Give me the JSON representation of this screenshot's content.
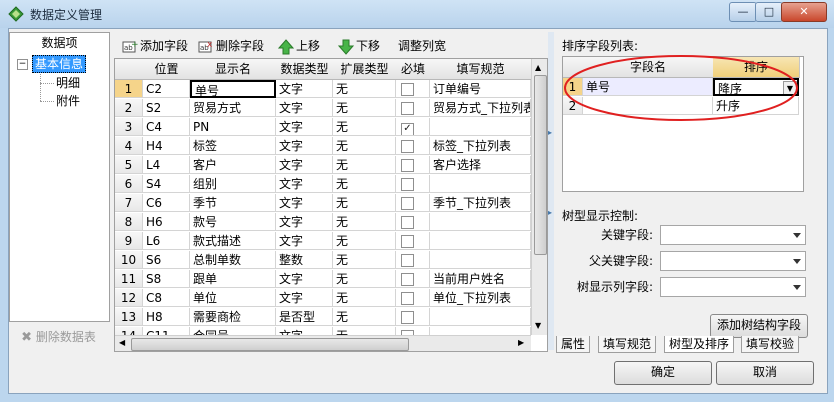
{
  "window": {
    "title": "数据定义管理",
    "buttons": {
      "minimize": "—",
      "maximize": "□",
      "close": "✕"
    }
  },
  "left_panel": {
    "header": "数据项",
    "tree": [
      {
        "label": "基本信息",
        "selected": true,
        "expanded": true
      },
      {
        "label": "明细"
      },
      {
        "label": "附件"
      }
    ],
    "delete_button": "删除数据表"
  },
  "toolbar": {
    "add_field": "添加字段",
    "delete_field": "删除字段",
    "move_up": "上移",
    "move_down": "下移",
    "adjust_width": "调整列宽"
  },
  "grid": {
    "columns": [
      "",
      "位置",
      "显示名",
      "数据类型",
      "扩展类型",
      "必填",
      "填写规范"
    ],
    "rows": [
      {
        "n": "1",
        "pos": "C2",
        "name": "单号",
        "type": "文字",
        "ext": "无",
        "req": false,
        "rule": "订单编号"
      },
      {
        "n": "2",
        "pos": "S2",
        "name": "贸易方式",
        "type": "文字",
        "ext": "无",
        "req": false,
        "rule": "贸易方式_下拉列表"
      },
      {
        "n": "3",
        "pos": "C4",
        "name": "PN",
        "type": "文字",
        "ext": "无",
        "req": true,
        "rule": ""
      },
      {
        "n": "4",
        "pos": "H4",
        "name": "标签",
        "type": "文字",
        "ext": "无",
        "req": false,
        "rule": "标签_下拉列表"
      },
      {
        "n": "5",
        "pos": "L4",
        "name": "客户",
        "type": "文字",
        "ext": "无",
        "req": false,
        "rule": "客户选择"
      },
      {
        "n": "6",
        "pos": "S4",
        "name": "组别",
        "type": "文字",
        "ext": "无",
        "req": false,
        "rule": ""
      },
      {
        "n": "7",
        "pos": "C6",
        "name": "季节",
        "type": "文字",
        "ext": "无",
        "req": false,
        "rule": "季节_下拉列表"
      },
      {
        "n": "8",
        "pos": "H6",
        "name": "款号",
        "type": "文字",
        "ext": "无",
        "req": false,
        "rule": ""
      },
      {
        "n": "9",
        "pos": "L6",
        "name": "款式描述",
        "type": "文字",
        "ext": "无",
        "req": false,
        "rule": ""
      },
      {
        "n": "10",
        "pos": "S6",
        "name": "总制单数",
        "type": "整数",
        "ext": "无",
        "req": false,
        "rule": ""
      },
      {
        "n": "11",
        "pos": "S8",
        "name": "跟单",
        "type": "文字",
        "ext": "无",
        "req": false,
        "rule": "当前用户姓名"
      },
      {
        "n": "12",
        "pos": "C8",
        "name": "单位",
        "type": "文字",
        "ext": "无",
        "req": false,
        "rule": "单位_下拉列表"
      },
      {
        "n": "13",
        "pos": "H8",
        "name": "需要商检",
        "type": "是否型",
        "ext": "无",
        "req": false,
        "rule": ""
      },
      {
        "n": "14",
        "pos": "C11",
        "name": "合同号",
        "type": "文字",
        "ext": "无",
        "req": false,
        "rule": ""
      }
    ]
  },
  "sort_panel": {
    "label": "排序字段列表:",
    "columns": [
      "",
      "字段名",
      "排序"
    ],
    "rows": [
      {
        "n": "1",
        "field": "单号",
        "order": "降序"
      },
      {
        "n": "2",
        "field": "",
        "order": "升序"
      }
    ]
  },
  "tree_control": {
    "label": "树型显示控制:",
    "key_field": "关键字段:",
    "parent_key_field": "父关键字段:",
    "display_field": "树显示列字段:",
    "key_value": "",
    "parent_value": "",
    "display_value": "",
    "add_button": "添加树结构字段"
  },
  "right_tabs": [
    "属性",
    "填写规范",
    "树型及排序",
    "填写校验"
  ],
  "dialog_buttons": {
    "ok": "确定",
    "cancel": "取消"
  },
  "colors": {
    "selection": "#3399ff",
    "highlight_ellipse": "#e02020",
    "row_header_selected": "#f5d48a"
  }
}
